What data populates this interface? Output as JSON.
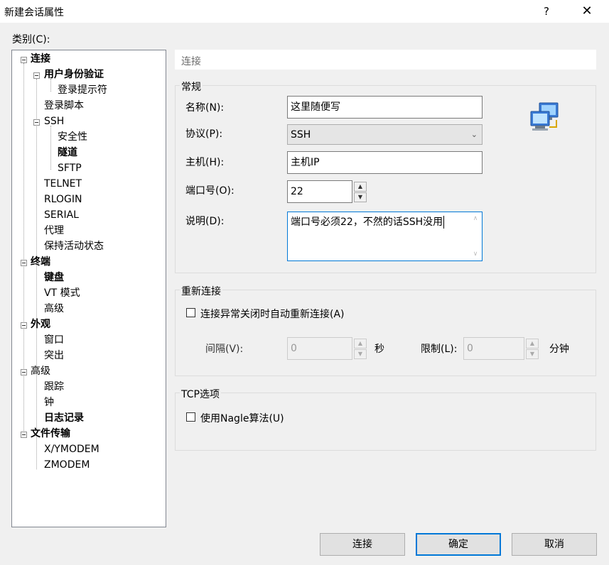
{
  "window": {
    "title": "新建会话属性",
    "help": "?",
    "close": "✕"
  },
  "category_label": "类别(C):",
  "tree": [
    {
      "label": "连接",
      "bold": true
    },
    {
      "label": "用户身份验证",
      "bold": true
    },
    {
      "label": "登录提示符",
      "bold": false
    },
    {
      "label": "登录脚本",
      "bold": false
    },
    {
      "label": "SSH",
      "bold": false
    },
    {
      "label": "安全性",
      "bold": false
    },
    {
      "label": "隧道",
      "bold": true
    },
    {
      "label": "SFTP",
      "bold": false
    },
    {
      "label": "TELNET",
      "bold": false
    },
    {
      "label": "RLOGIN",
      "bold": false
    },
    {
      "label": "SERIAL",
      "bold": false
    },
    {
      "label": "代理",
      "bold": false
    },
    {
      "label": "保持活动状态",
      "bold": false
    },
    {
      "label": "终端",
      "bold": true
    },
    {
      "label": "键盘",
      "bold": true
    },
    {
      "label": "VT 模式",
      "bold": false
    },
    {
      "label": "高级",
      "bold": false
    },
    {
      "label": "外观",
      "bold": true
    },
    {
      "label": "窗口",
      "bold": false
    },
    {
      "label": "突出",
      "bold": false
    },
    {
      "label": "高级",
      "bold": false
    },
    {
      "label": "跟踪",
      "bold": false
    },
    {
      "label": "钟",
      "bold": false
    },
    {
      "label": "日志记录",
      "bold": true
    },
    {
      "label": "文件传输",
      "bold": true
    },
    {
      "label": "X/YMODEM",
      "bold": false
    },
    {
      "label": "ZMODEM",
      "bold": false
    }
  ],
  "panel": {
    "header": "连接"
  },
  "general": {
    "title": "常规",
    "name_label": "名称(N):",
    "name_value": "这里随便写",
    "protocol_label": "协议(P):",
    "protocol_value": "SSH",
    "host_label": "主机(H):",
    "host_value": "主机IP",
    "port_label": "端口号(O):",
    "port_value": "22",
    "desc_label": "说明(D):",
    "desc_value": "端口号必须22，不然的话SSH没用"
  },
  "reconnect": {
    "title": "重新连接",
    "checkbox_label": "连接异常关闭时自动重新连接(A)",
    "interval_label": "间隔(V):",
    "interval_value": "0",
    "interval_unit": "秒",
    "limit_label": "限制(L):",
    "limit_value": "0",
    "limit_unit": "分钟"
  },
  "tcp": {
    "title": "TCP选项",
    "nagle_label": "使用Nagle算法(U)"
  },
  "buttons": {
    "connect": "连接",
    "ok": "确定",
    "cancel": "取消"
  },
  "icons": {
    "tree_expander": "minus-box-icon",
    "network": "network-computers-icon"
  }
}
